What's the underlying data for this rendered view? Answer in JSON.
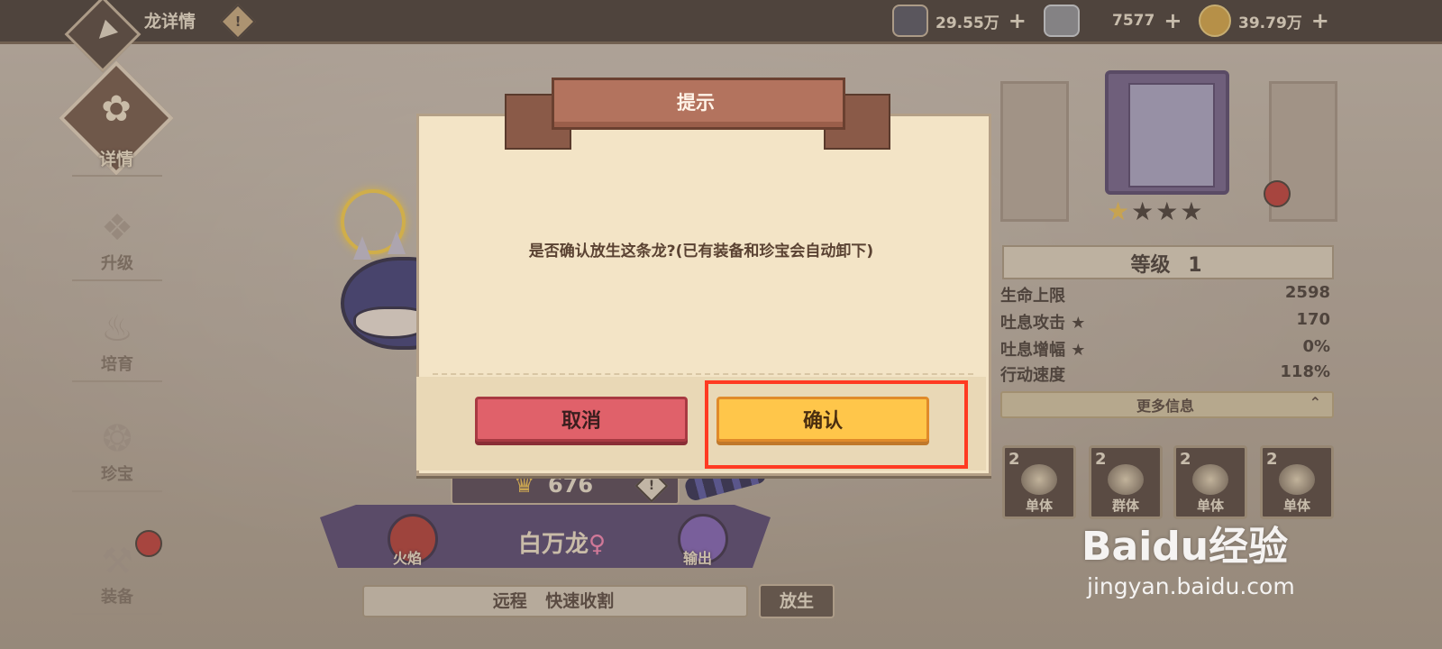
{
  "header": {
    "title": "龙详情",
    "info_mark": "!",
    "resources": [
      {
        "icon": "mana-pot-icon",
        "value": "29.55万"
      },
      {
        "icon": "iron-ingot-icon",
        "value": "7577"
      },
      {
        "icon": "gold-coin-icon",
        "value": "39.79万"
      }
    ],
    "plus": "+"
  },
  "nav": {
    "items": [
      {
        "label": "详情",
        "active": true
      },
      {
        "label": "升级"
      },
      {
        "label": "培育"
      },
      {
        "label": "珍宝"
      },
      {
        "label": "装备"
      }
    ]
  },
  "dragon": {
    "power": "676",
    "info_mark": "!",
    "element_left": "火焰",
    "element_right": "输出",
    "name": "白万龙",
    "gender": "♀",
    "traits": "远程 快速收割",
    "release_label": "放生"
  },
  "right_panel": {
    "stars_total": 4,
    "stars_on": 1,
    "level_label": "等级",
    "level_value": "1",
    "stats": [
      {
        "name": "生命上限",
        "value": "2598"
      },
      {
        "name": "吐息攻击 ★",
        "value": "170"
      },
      {
        "name": "吐息增幅 ★",
        "value": "0%"
      },
      {
        "name": "行动速度",
        "value": "118%"
      }
    ],
    "more_info": "更多信息",
    "skills": [
      {
        "level": "2",
        "label": "单体"
      },
      {
        "level": "2",
        "label": "群体"
      },
      {
        "level": "2",
        "label": "单体"
      },
      {
        "level": "2",
        "label": "单体"
      }
    ]
  },
  "dialog": {
    "title": "提示",
    "message": "是否确认放生这条龙?(已有装备和珍宝会自动卸下)",
    "cancel_label": "取消",
    "confirm_label": "确认"
  },
  "watermark": {
    "brand": "Baidu经验",
    "url": "jingyan.baidu.com"
  },
  "colors": {
    "cancel": "#e0616a",
    "confirm": "#ffc64a",
    "highlight": "#ff3a22"
  }
}
